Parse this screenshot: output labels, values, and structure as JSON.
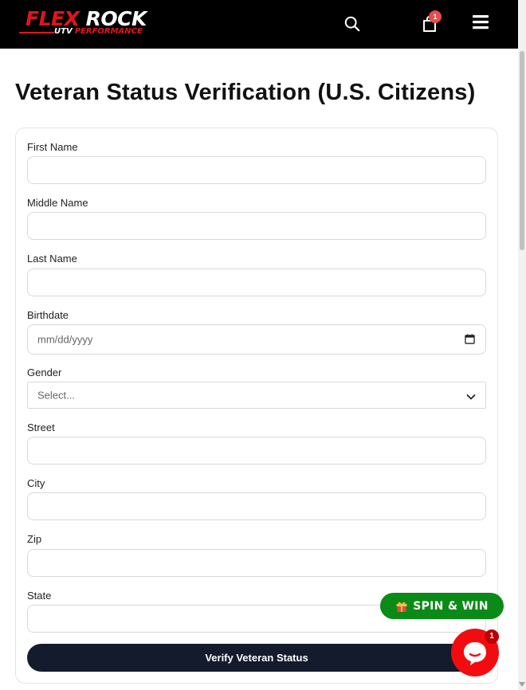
{
  "header": {
    "logo": {
      "word1": "FLEX",
      "word2": "ROCK",
      "sub1": "UTV",
      "sub2": "PERFORMANCE"
    },
    "cart_count": "1",
    "icons": {
      "search": "search-icon",
      "cart": "shopping-bag-icon",
      "menu": "hamburger-menu-icon"
    }
  },
  "page_title": "Veteran Status Verification (U.S. Citizens)",
  "form": {
    "first_name": {
      "label": "First Name",
      "value": ""
    },
    "middle_name": {
      "label": "Middle Name",
      "value": ""
    },
    "last_name": {
      "label": "Last Name",
      "value": ""
    },
    "birthdate": {
      "label": "Birthdate",
      "placeholder": "mm/dd/yyyy"
    },
    "gender": {
      "label": "Gender",
      "selected": "Select..."
    },
    "street": {
      "label": "Street",
      "value": ""
    },
    "city": {
      "label": "City",
      "value": ""
    },
    "zip": {
      "label": "Zip",
      "value": ""
    },
    "state": {
      "label": "State",
      "value": ""
    },
    "submit_label": "Verify Veteran Status"
  },
  "widgets": {
    "spin_label": "SPIN & WIN",
    "chat_badge": "1"
  },
  "colors": {
    "brand_red": "#e0151b",
    "header_bg": "#000000",
    "button_dark": "#141b2d",
    "spin_green": "#0a8a16",
    "chat_red": "#f20c10"
  }
}
